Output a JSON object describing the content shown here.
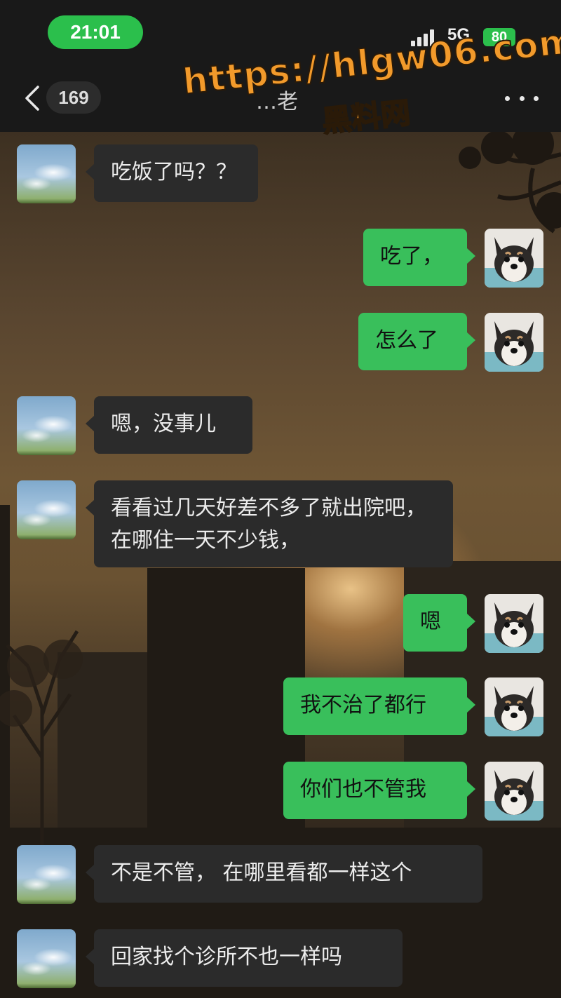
{
  "status_bar": {
    "time": "21:01",
    "network": "5G",
    "battery": "80"
  },
  "nav": {
    "unread_count": "169",
    "title": "…老"
  },
  "watermark": {
    "url": "https://hlgw06.com",
    "name": "黑料网"
  },
  "avatars": {
    "contact": "sky-landscape-avatar",
    "me": "shiba-dog-avatar"
  },
  "messages": [
    {
      "side": "incoming",
      "text": "吃饭了吗？？"
    },
    {
      "side": "outgoing",
      "text": "吃了，"
    },
    {
      "side": "outgoing",
      "text": "怎么了"
    },
    {
      "side": "incoming",
      "text": "嗯，没事儿"
    },
    {
      "side": "incoming",
      "text": "看看过几天好差不多了就出院吧，在哪住一天不少钱，"
    },
    {
      "side": "outgoing",
      "text": "嗯"
    },
    {
      "side": "outgoing",
      "text": "我不治了都行"
    },
    {
      "side": "outgoing",
      "text": "你们也不管我"
    },
    {
      "side": "incoming",
      "text": "不是不管， 在哪里看都一样这个"
    },
    {
      "side": "incoming",
      "text": "回家找个诊所不也一样吗"
    }
  ],
  "colors": {
    "outgoing_bubble": "#39bf5b",
    "incoming_bubble": "#2b2b2b",
    "status_pill": "#2bbf4c",
    "watermark": "#f29a2b"
  }
}
